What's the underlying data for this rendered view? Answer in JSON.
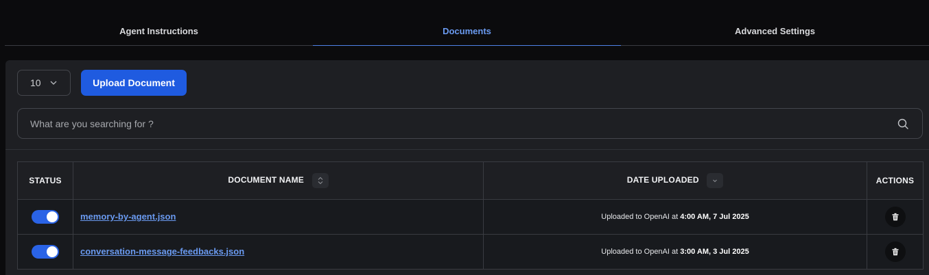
{
  "tabs": [
    {
      "label": "Agent Instructions",
      "active": false
    },
    {
      "label": "Documents",
      "active": true
    },
    {
      "label": "Advanced Settings",
      "active": false
    }
  ],
  "toolbar": {
    "page_size": "10",
    "upload_label": "Upload Document"
  },
  "search": {
    "placeholder": "What are you searching for ?",
    "value": ""
  },
  "table": {
    "headers": {
      "status": "STATUS",
      "name": "DOCUMENT NAME",
      "date": "DATE UPLOADED",
      "actions": "ACTIONS"
    },
    "rows": [
      {
        "enabled": true,
        "name": "memory-by-agent.json",
        "date_prefix": "Uploaded to OpenAI at",
        "date_value": "4:00 AM, 7 Jul 2025"
      },
      {
        "enabled": true,
        "name": "conversation-message-feedbacks.json",
        "date_prefix": "Uploaded to OpenAI at",
        "date_value": "3:00 AM, 3 Jul 2025"
      }
    ]
  },
  "colors": {
    "accent": "#1f5be0",
    "link": "#6a9af0",
    "toggle_on": "#2a63e6",
    "panel_bg": "#1e1f23",
    "page_bg": "#0b0b0d"
  },
  "icons": [
    "chevron-down-icon",
    "search-icon",
    "sort-icon",
    "trash-icon"
  ]
}
